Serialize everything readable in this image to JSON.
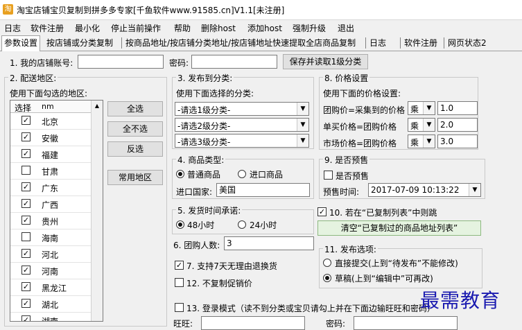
{
  "window": {
    "title": "淘宝店铺宝贝复制到拼多多专家[千鱼软件www.91585.cn]V1.1[未注册]"
  },
  "menu": [
    "日志",
    "软件注册",
    "最小化",
    "停止当前操作",
    "帮助",
    "删除host",
    "添加host",
    "强制升级",
    "退出"
  ],
  "tabs": [
    "参数设置",
    "按店铺或分类复制",
    "按商品地址/按店铺分类地址/按店铺地址快速提取全店商品复制",
    "日志",
    "软件注册",
    "网页状态2"
  ],
  "account": {
    "label": "1. 我的店铺账号:",
    "value": "",
    "password_label": "密码:",
    "password_value": "",
    "save_button": "保存并读取1级分类"
  },
  "region": {
    "legend": "2. 配送地区:",
    "hint": "使用下面勾选的地区:",
    "col_select": "选择",
    "col_name": "nm",
    "rows": [
      {
        "name": "北京",
        "checked": true
      },
      {
        "name": "安徽",
        "checked": true
      },
      {
        "name": "福建",
        "checked": true
      },
      {
        "name": "甘肃",
        "checked": false
      },
      {
        "name": "广东",
        "checked": true
      },
      {
        "name": "广西",
        "checked": true
      },
      {
        "name": "贵州",
        "checked": true
      },
      {
        "name": "海南",
        "checked": false
      },
      {
        "name": "河北",
        "checked": true
      },
      {
        "name": "河南",
        "checked": true
      },
      {
        "name": "黑龙江",
        "checked": true
      },
      {
        "name": "湖北",
        "checked": true
      },
      {
        "name": "湖南",
        "checked": true
      }
    ],
    "select_all": "全选",
    "select_none": "全不选",
    "invert": "反选",
    "common": "常用地区"
  },
  "category": {
    "legend": "3. 发布到分类:",
    "hint": "使用下面选择的分类:",
    "level1": "-请选1级分类-",
    "level2": "-请选2级分类-",
    "level3": "-请选3级分类-"
  },
  "goods_type": {
    "legend": "4. 商品类型:",
    "normal": "普通商品",
    "import": "进口商品",
    "country_label": "进口国家:",
    "country_value": "美国"
  },
  "ship_time": {
    "legend": "5. 发货时间承诺:",
    "h48": "48小时",
    "h24": "24小时"
  },
  "group_size": {
    "label": "6. 团购人数:",
    "value": "3"
  },
  "options": {
    "seven_day": "7. 支持7天无理由退换货",
    "no_copy_promo": "12. 不复制促销价",
    "login_mode": "13. 登录模式（读不到分类或宝贝请勾上并在下面边输旺旺和密码）"
  },
  "price": {
    "legend": "8. 价格设置",
    "hint": "使用下面的价格设置:",
    "rows": [
      {
        "label": "团购价=采集到的价格",
        "op": "乘",
        "value": "1.0"
      },
      {
        "label": "单买价格=团购价格",
        "op": "乘",
        "value": "2.0"
      },
      {
        "label": "市场价格=团购价格",
        "op": "乘",
        "value": "3.0"
      }
    ]
  },
  "presale": {
    "legend": "9. 是否预售",
    "checkbox": "是否预售",
    "time_label": "预售时间:",
    "time_value": "2017-07-09 10:13:22"
  },
  "skip_copied": {
    "label": "10. 若在“已复制列表”中则跳",
    "clear_button": "清空“已复制过的商品地址列表”"
  },
  "publish": {
    "legend": "11. 发布选项:",
    "direct": "直接提交(上到“待发布”不能修改)",
    "draft": "草稿(上到“编辑中”可再改)"
  },
  "bottom": {
    "ww_label": "旺旺:",
    "pwd_label": "密码:"
  },
  "watermark": "最需教育"
}
